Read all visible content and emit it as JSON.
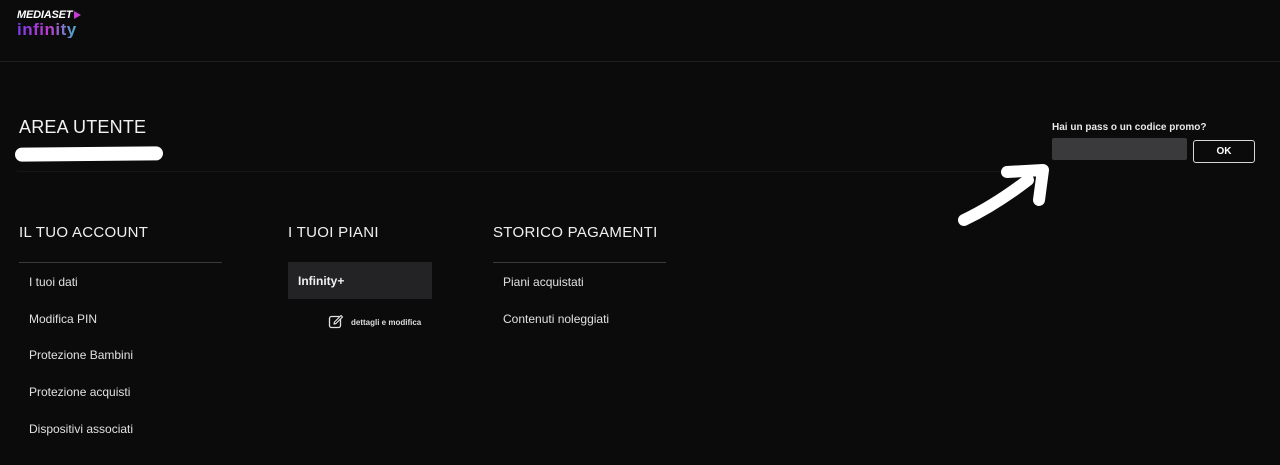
{
  "header": {
    "brand_top": "MEDIASET",
    "brand_bottom": "infinity"
  },
  "area": {
    "title": "AREA UTENTE"
  },
  "promo": {
    "label": "Hai un pass o un codice promo?",
    "input_value": "",
    "ok_label": "OK"
  },
  "account": {
    "heading": "IL TUO ACCOUNT",
    "items": [
      "I tuoi dati",
      "Modifica PIN",
      "Protezione Bambini",
      "Protezione acquisti",
      "Dispositivi associati"
    ]
  },
  "plans": {
    "heading": "I TUOI PIANI",
    "active_plan": "Infinity+",
    "edit_label": "dettagli e modifica"
  },
  "payments": {
    "heading": "STORICO PAGAMENTI",
    "items": [
      "Piani acquistati",
      "Contenuti noleggiati"
    ]
  }
}
